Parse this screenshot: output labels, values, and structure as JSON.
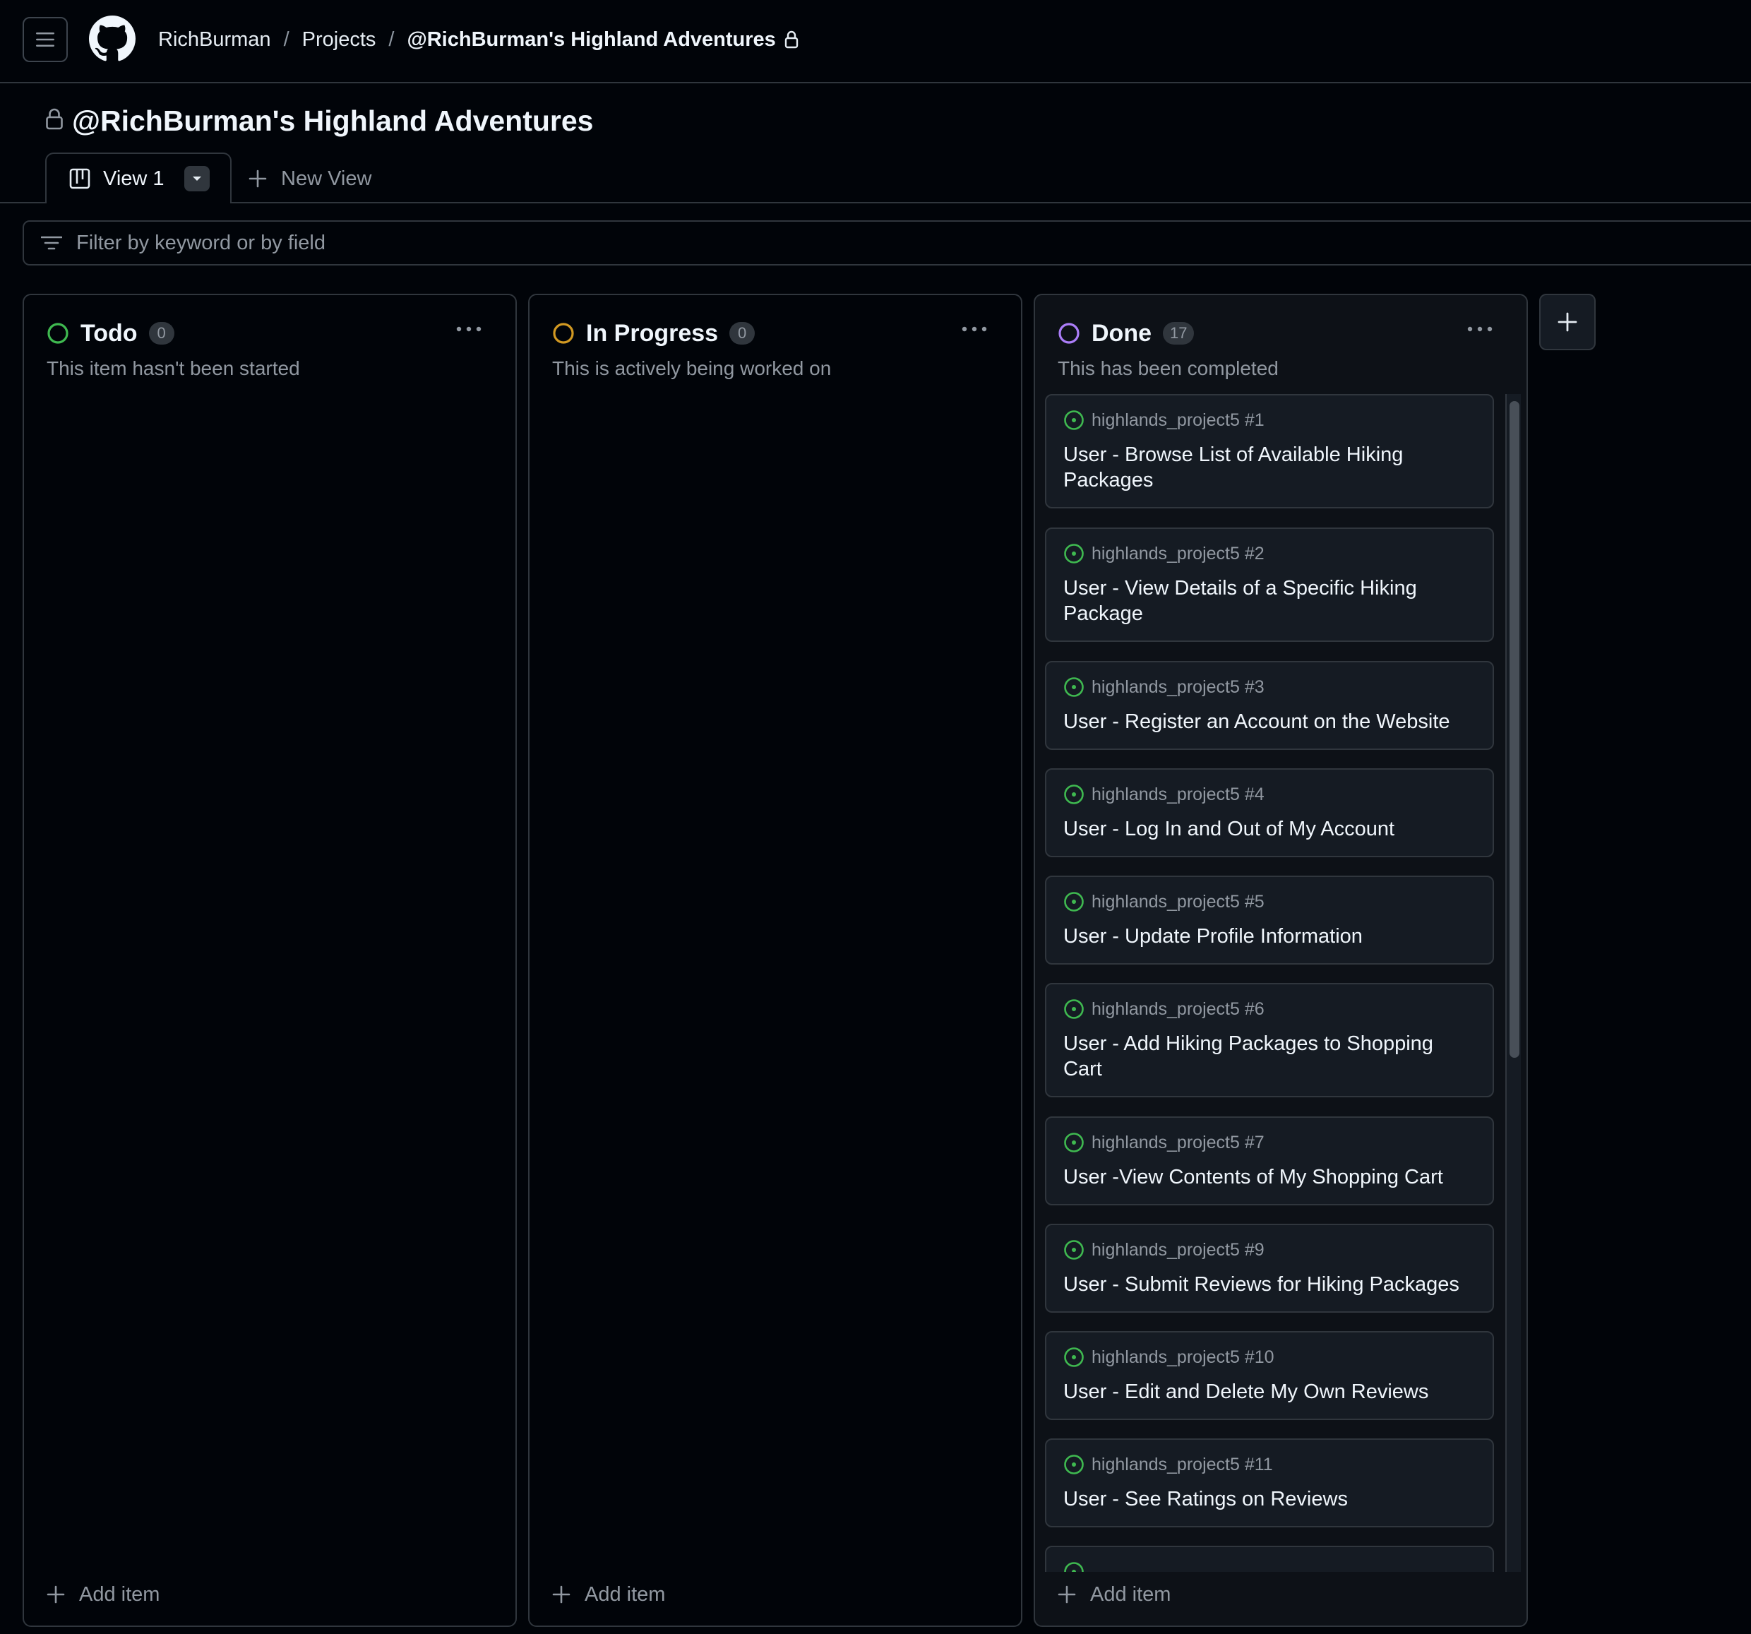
{
  "header": {
    "breadcrumbs": [
      "RichBurman",
      "Projects"
    ],
    "separator": "/",
    "current": "@RichBurman's Highland Adventures"
  },
  "project": {
    "title": "@RichBurman's Highland Adventures"
  },
  "tabs": {
    "active_label": "View 1",
    "new_view_label": "New View"
  },
  "filter": {
    "placeholder": "Filter by keyword or by field"
  },
  "colors": {
    "todo": "#3fb950",
    "in_progress": "#d29922",
    "done": "#ab7df8",
    "issue_open": "#3fb950"
  },
  "columns": {
    "todo": {
      "name": "Todo",
      "count": "0",
      "description": "This item hasn't been started",
      "add_label": "Add item"
    },
    "in_progress": {
      "name": "In Progress",
      "count": "0",
      "description": "This is actively being worked on",
      "add_label": "Add item"
    },
    "done": {
      "name": "Done",
      "count": "17",
      "description": "This has been completed",
      "add_label": "Add item",
      "cards": [
        {
          "ref": "highlands_project5 #1",
          "title": "User - Browse List of Available Hiking Packages"
        },
        {
          "ref": "highlands_project5 #2",
          "title": "User - View Details of a Specific Hiking Package"
        },
        {
          "ref": "highlands_project5 #3",
          "title": "User - Register an Account on the Website"
        },
        {
          "ref": "highlands_project5 #4",
          "title": "User - Log In and Out of My Account"
        },
        {
          "ref": "highlands_project5 #5",
          "title": "User - Update Profile Information"
        },
        {
          "ref": "highlands_project5 #6",
          "title": "User - Add Hiking Packages to Shopping Cart"
        },
        {
          "ref": "highlands_project5 #7",
          "title": "User -View Contents of My Shopping Cart"
        },
        {
          "ref": "highlands_project5 #9",
          "title": "User - Submit Reviews for Hiking Packages"
        },
        {
          "ref": "highlands_project5 #10",
          "title": "User - Edit and Delete My Own Reviews"
        },
        {
          "ref": "highlands_project5 #11",
          "title": "User - See Ratings on Reviews"
        }
      ]
    }
  }
}
